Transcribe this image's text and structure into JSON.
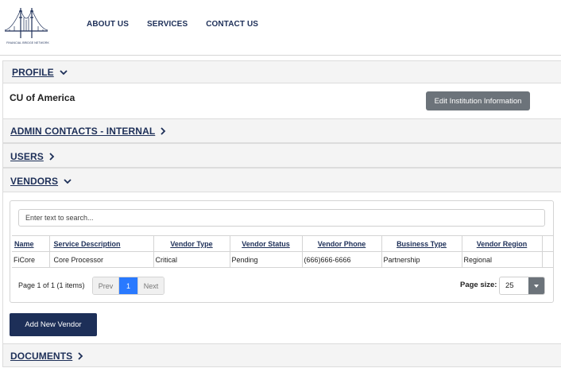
{
  "header": {
    "logo_text": "FINANCIAL BRIDGE NETWORK",
    "nav": [
      "ABOUT US",
      "SERVICES",
      "CONTACT US"
    ]
  },
  "sections": {
    "profile": "PROFILE",
    "admin_contacts": "ADMIN CONTACTS - INTERNAL",
    "users": "USERS",
    "vendors": "VENDORS",
    "documents": "DOCUMENTS"
  },
  "profile": {
    "institution_name": "CU of America",
    "edit_button": "Edit Institution Information"
  },
  "vendors": {
    "search_placeholder": "Enter text to search...",
    "columns": [
      "Name",
      "Service Description",
      "Vendor Type",
      "Vendor Status",
      "Vendor Phone",
      "Business Type",
      "Vendor Region"
    ],
    "rows": [
      [
        "FiCore",
        "Core Processor",
        "Critical",
        "Pending",
        "(666)666-6666",
        "Partnership",
        "Regional"
      ]
    ],
    "pager_info": "Page 1 of 1 (1 items)",
    "prev_label": "Prev",
    "current_page": "1",
    "next_label": "Next",
    "page_size_label": "Page size:",
    "page_size": "25",
    "add_button": "Add New Vendor"
  },
  "colors": {
    "brand": "#1d2f58",
    "button_gray": "#6c737a",
    "pager_active": "#2979ff"
  }
}
